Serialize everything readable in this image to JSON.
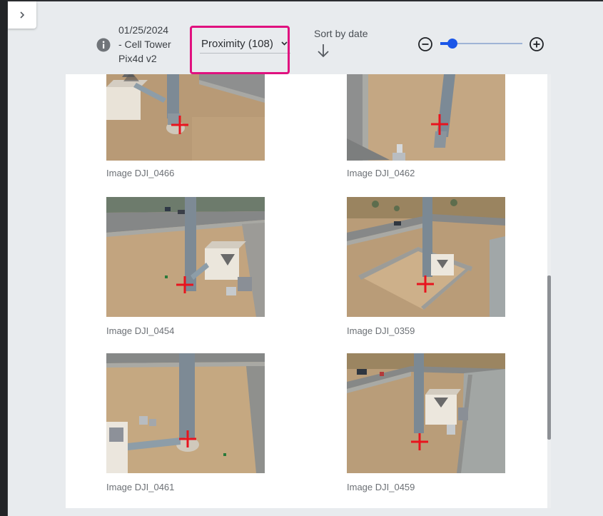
{
  "project": {
    "name_lines": [
      "01/25/2024",
      "- Cell Tower",
      "Pix4d v2"
    ]
  },
  "filter": {
    "selected": "Proximity (108)"
  },
  "sort": {
    "label": "Sort by date"
  },
  "zoom": {
    "level": 0.15
  },
  "images": [
    {
      "caption": "Image DJI_0466"
    },
    {
      "caption": "Image DJI_0462"
    },
    {
      "caption": "Image DJI_0454"
    },
    {
      "caption": "Image DJI_0359"
    },
    {
      "caption": "Image DJI_0461"
    },
    {
      "caption": "Image DJI_0459"
    }
  ],
  "colors": {
    "accent": "#1a56e8",
    "highlight": "#e0117f",
    "marker": "#e8141e"
  }
}
